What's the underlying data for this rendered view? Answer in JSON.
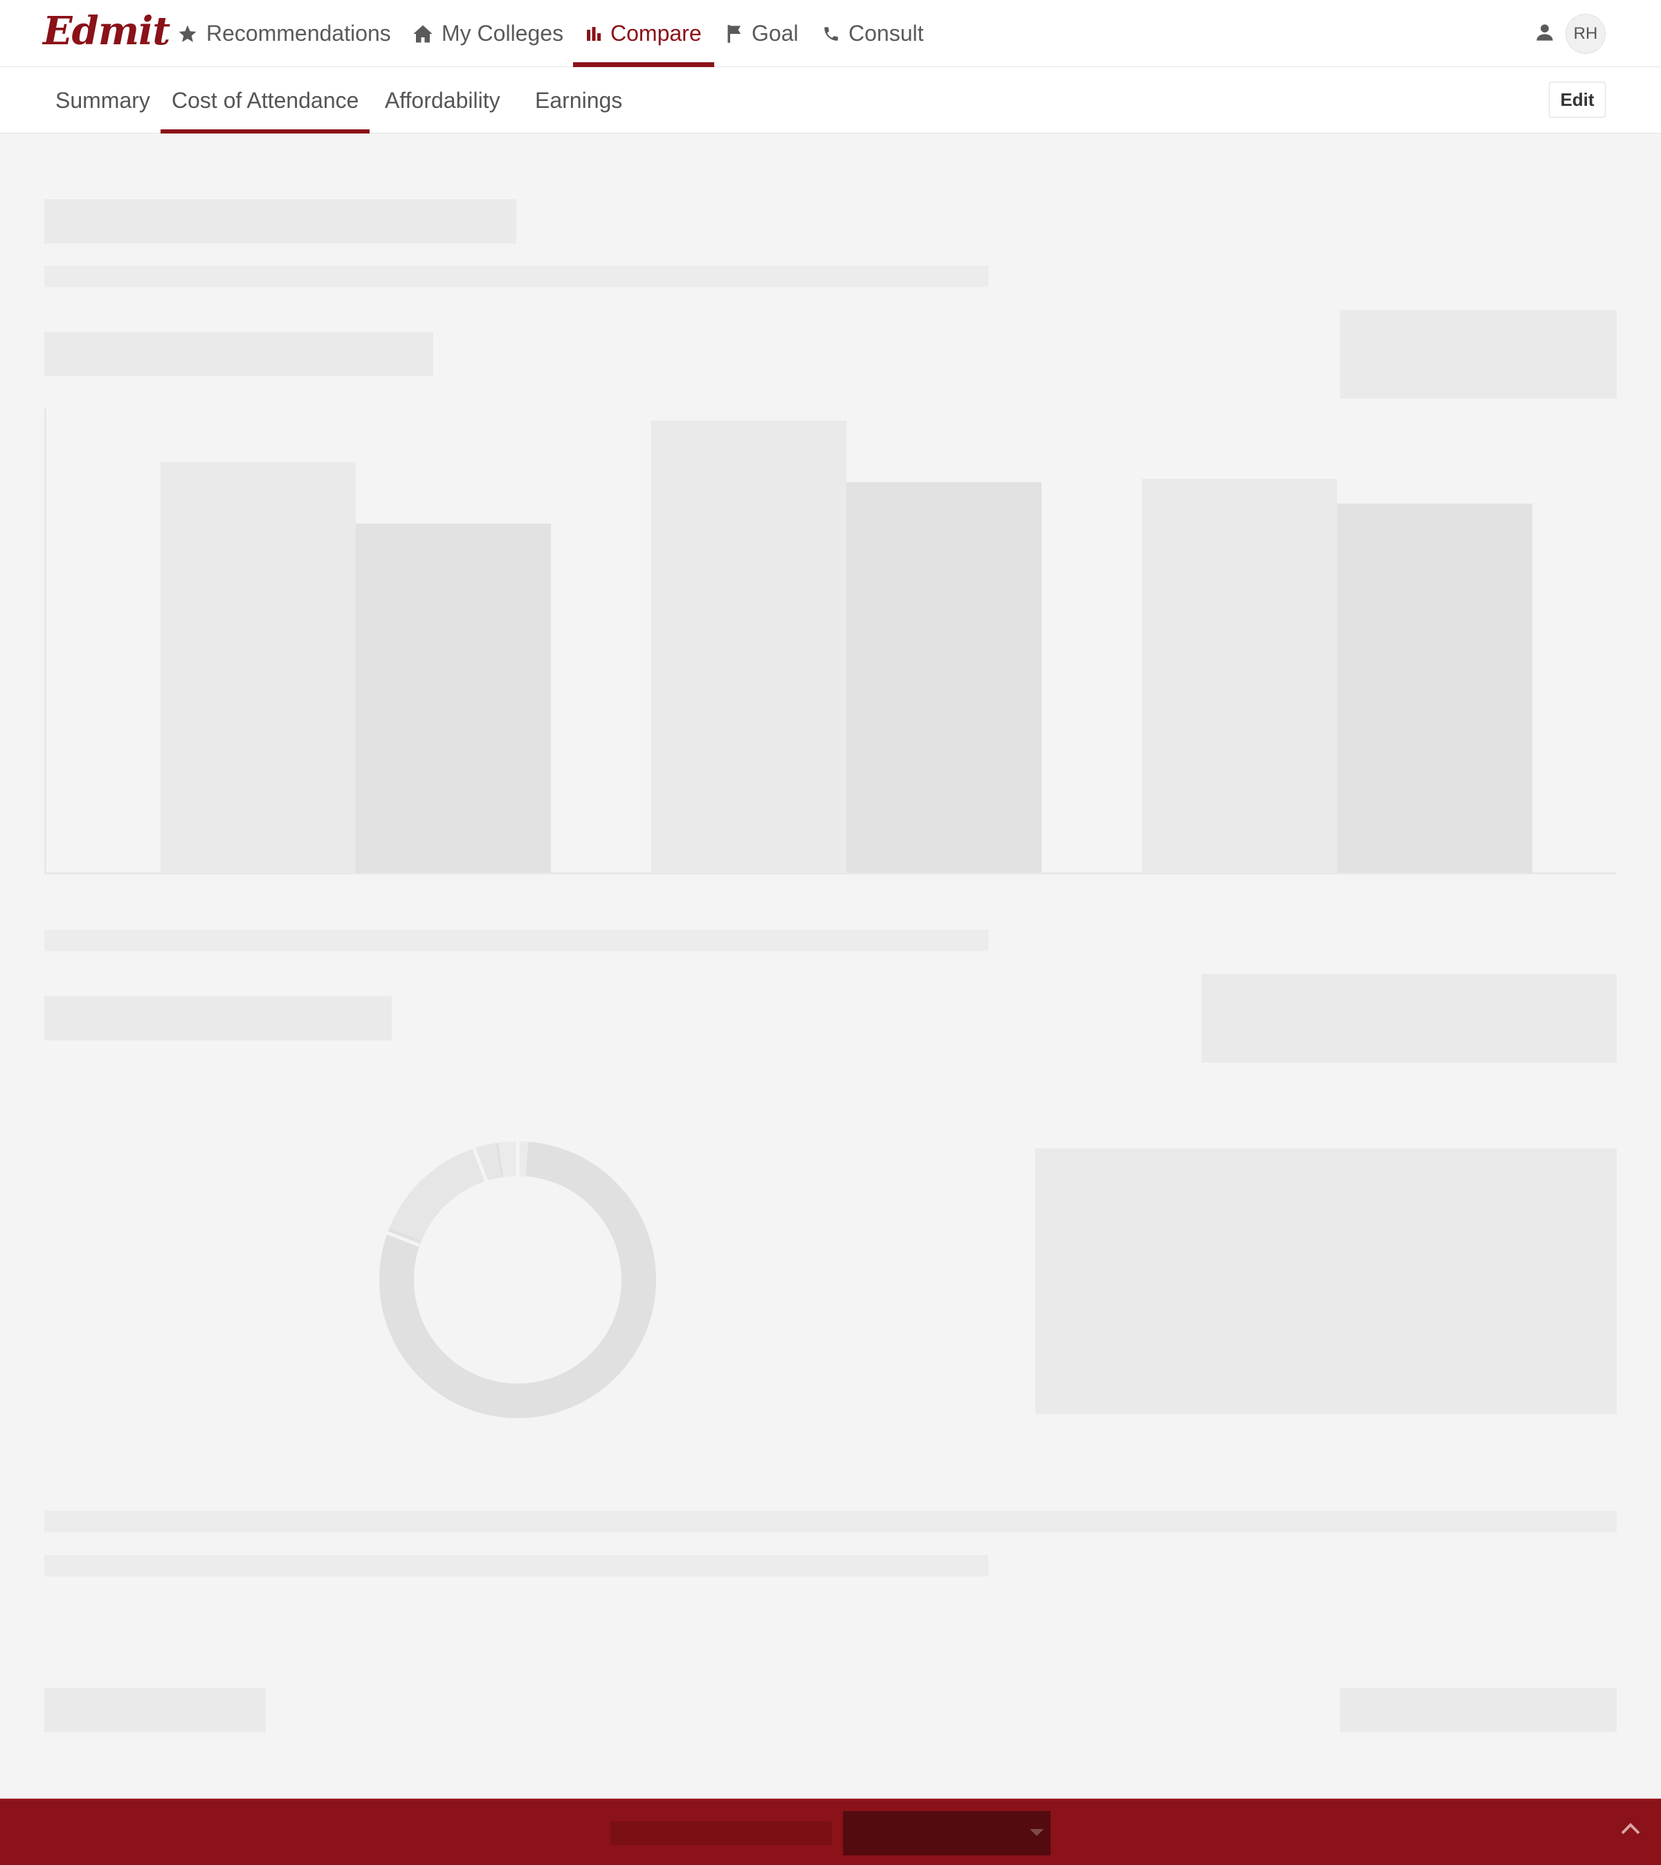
{
  "brand": {
    "logo": "Edmit",
    "accent_color": "#8a1218"
  },
  "topnav": {
    "items": [
      {
        "label": "Recommendations",
        "icon": "star-icon",
        "active": false
      },
      {
        "label": "My Colleges",
        "icon": "home-icon",
        "active": false
      },
      {
        "label": "Compare",
        "icon": "bar-chart-icon",
        "active": true
      },
      {
        "label": "Goal",
        "icon": "flag-icon",
        "active": false
      },
      {
        "label": "Consult",
        "icon": "phone-icon",
        "active": false
      }
    ],
    "user_icon": "person-icon",
    "avatar_initials": "RH"
  },
  "subnav": {
    "tabs": [
      {
        "label": "Summary",
        "active": false
      },
      {
        "label": "Cost of Attendance",
        "active": true
      },
      {
        "label": "Affordability",
        "active": false
      },
      {
        "label": "Earnings",
        "active": false
      }
    ],
    "edit_label": "Edit"
  },
  "loading_state": true,
  "footer_bar": {
    "collapse_icon": "chevron-up-icon",
    "dropdown_icon": "caret-down-icon"
  }
}
